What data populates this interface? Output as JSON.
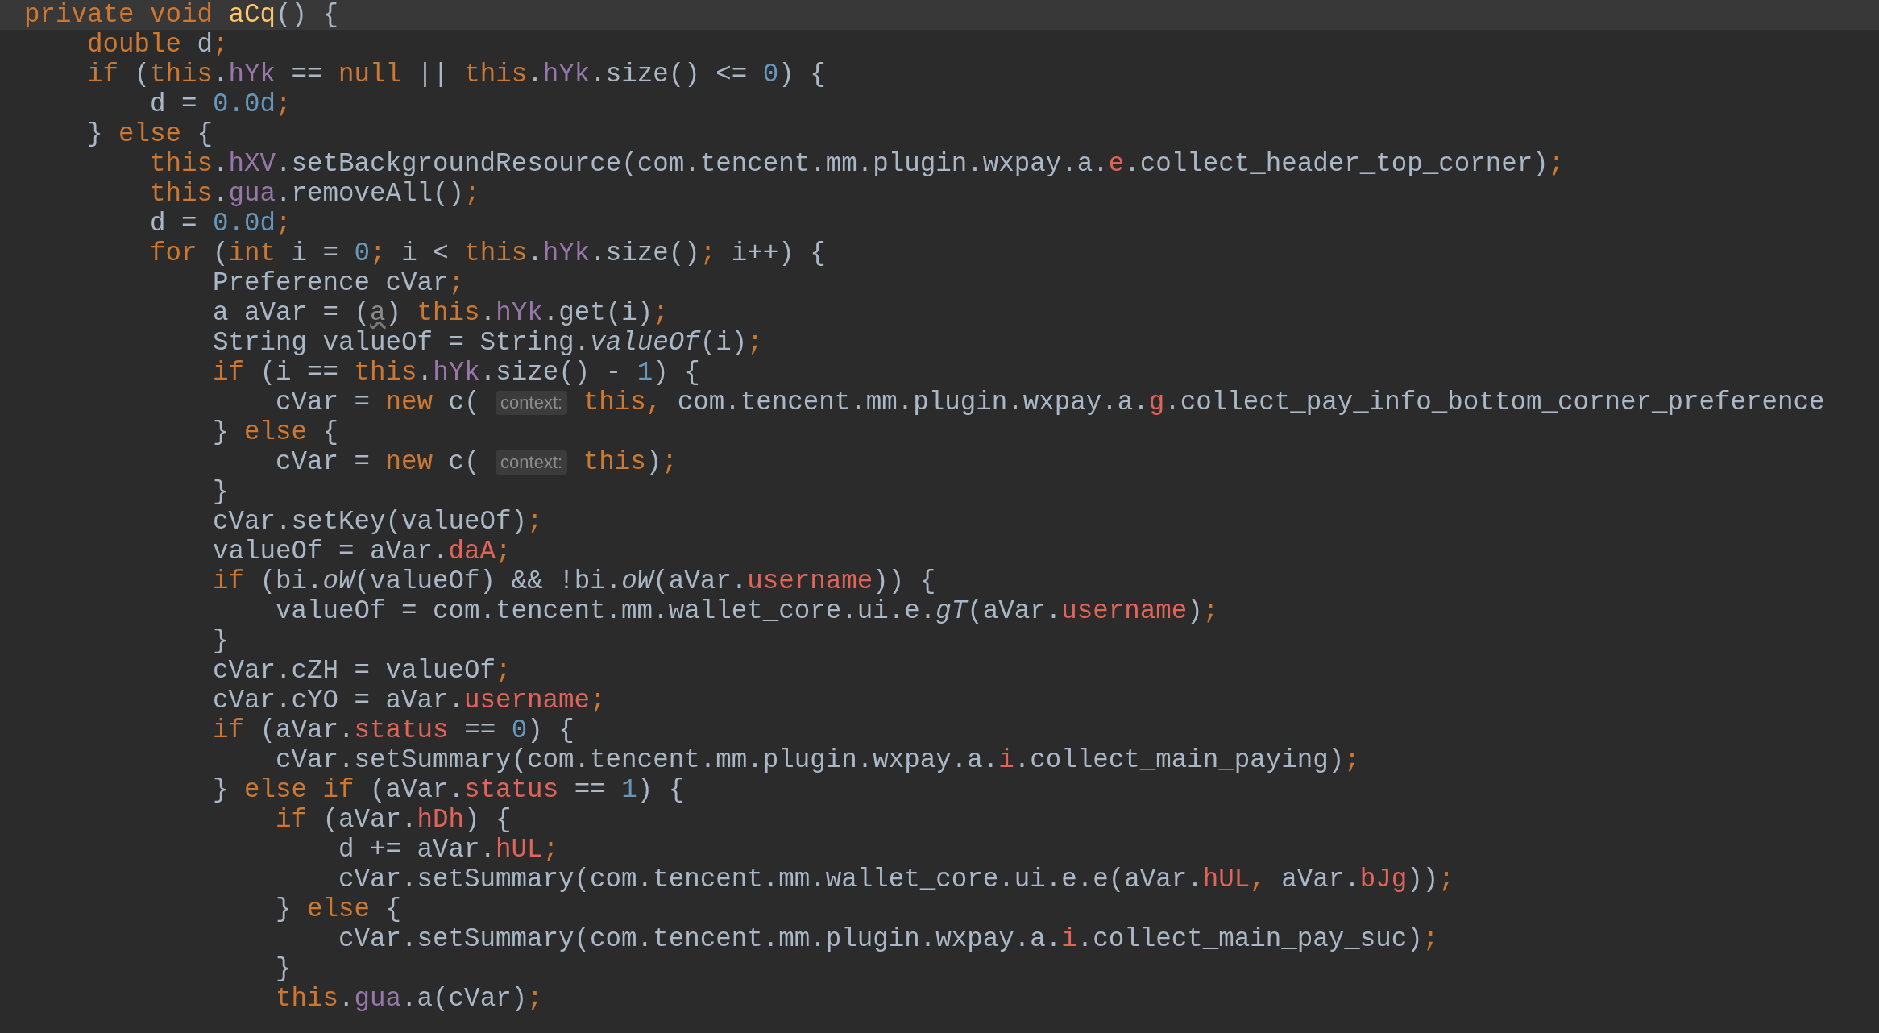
{
  "editor": {
    "lines": [
      {
        "current": true,
        "tokens": [
          {
            "kind": "keyword",
            "text": "private void "
          },
          {
            "kind": "declaration",
            "text": "aCq"
          },
          {
            "kind": "plain",
            "text": "() {"
          }
        ]
      },
      {
        "current": false,
        "tokens": [
          {
            "kind": "keyword",
            "text": "    double "
          },
          {
            "kind": "plain",
            "text": "d"
          },
          {
            "kind": "keyword",
            "text": ";"
          }
        ]
      },
      {
        "current": false,
        "tokens": [
          {
            "kind": "keyword",
            "text": "    if "
          },
          {
            "kind": "plain",
            "text": "("
          },
          {
            "kind": "keyword",
            "text": "this"
          },
          {
            "kind": "plain",
            "text": "."
          },
          {
            "kind": "field",
            "text": "hYk"
          },
          {
            "kind": "plain",
            "text": " == "
          },
          {
            "kind": "keyword",
            "text": "null"
          },
          {
            "kind": "plain",
            "text": " || "
          },
          {
            "kind": "keyword",
            "text": "this"
          },
          {
            "kind": "plain",
            "text": "."
          },
          {
            "kind": "field",
            "text": "hYk"
          },
          {
            "kind": "plain",
            "text": ".size() <= "
          },
          {
            "kind": "number",
            "text": "0"
          },
          {
            "kind": "plain",
            "text": ") {"
          }
        ]
      },
      {
        "current": false,
        "tokens": [
          {
            "kind": "plain",
            "text": "        d = "
          },
          {
            "kind": "number",
            "text": "0.0d"
          },
          {
            "kind": "keyword",
            "text": ";"
          }
        ]
      },
      {
        "current": false,
        "tokens": [
          {
            "kind": "plain",
            "text": "    } "
          },
          {
            "kind": "keyword",
            "text": "else "
          },
          {
            "kind": "plain",
            "text": "{"
          }
        ]
      },
      {
        "current": false,
        "tokens": [
          {
            "kind": "keyword",
            "text": "        this"
          },
          {
            "kind": "plain",
            "text": "."
          },
          {
            "kind": "field",
            "text": "hXV"
          },
          {
            "kind": "plain",
            "text": ".setBackgroundResource(com.tencent.mm.plugin.wxpay.a."
          },
          {
            "kind": "red",
            "text": "e"
          },
          {
            "kind": "plain",
            "text": ".collect_header_top_corner)"
          },
          {
            "kind": "keyword",
            "text": ";"
          }
        ]
      },
      {
        "current": false,
        "tokens": [
          {
            "kind": "keyword",
            "text": "        this"
          },
          {
            "kind": "plain",
            "text": "."
          },
          {
            "kind": "field",
            "text": "gua"
          },
          {
            "kind": "plain",
            "text": ".removeAll()"
          },
          {
            "kind": "keyword",
            "text": ";"
          }
        ]
      },
      {
        "current": false,
        "tokens": [
          {
            "kind": "plain",
            "text": "        d = "
          },
          {
            "kind": "number",
            "text": "0.0d"
          },
          {
            "kind": "keyword",
            "text": ";"
          }
        ]
      },
      {
        "current": false,
        "tokens": [
          {
            "kind": "keyword",
            "text": "        for "
          },
          {
            "kind": "plain",
            "text": "("
          },
          {
            "kind": "keyword",
            "text": "int "
          },
          {
            "kind": "plain",
            "text": "i = "
          },
          {
            "kind": "number",
            "text": "0"
          },
          {
            "kind": "keyword",
            "text": "; "
          },
          {
            "kind": "plain",
            "text": "i < "
          },
          {
            "kind": "keyword",
            "text": "this"
          },
          {
            "kind": "plain",
            "text": "."
          },
          {
            "kind": "field",
            "text": "hYk"
          },
          {
            "kind": "plain",
            "text": ".size()"
          },
          {
            "kind": "keyword",
            "text": "; "
          },
          {
            "kind": "plain",
            "text": "i++) {"
          }
        ]
      },
      {
        "current": false,
        "tokens": [
          {
            "kind": "plain",
            "text": "            Preference cVar"
          },
          {
            "kind": "keyword",
            "text": ";"
          }
        ]
      },
      {
        "current": false,
        "tokens": [
          {
            "kind": "plain",
            "text": "            a aVar = ("
          },
          {
            "kind": "muted",
            "text": "a"
          },
          {
            "kind": "plain",
            "text": ") "
          },
          {
            "kind": "keyword",
            "text": "this"
          },
          {
            "kind": "plain",
            "text": "."
          },
          {
            "kind": "field",
            "text": "hYk"
          },
          {
            "kind": "plain",
            "text": ".get(i)"
          },
          {
            "kind": "keyword",
            "text": ";"
          }
        ]
      },
      {
        "current": false,
        "tokens": [
          {
            "kind": "plain",
            "text": "            String valueOf = String."
          },
          {
            "kind": "static",
            "text": "valueOf"
          },
          {
            "kind": "plain",
            "text": "(i)"
          },
          {
            "kind": "keyword",
            "text": ";"
          }
        ]
      },
      {
        "current": false,
        "tokens": [
          {
            "kind": "keyword",
            "text": "            if "
          },
          {
            "kind": "plain",
            "text": "(i == "
          },
          {
            "kind": "keyword",
            "text": "this"
          },
          {
            "kind": "plain",
            "text": "."
          },
          {
            "kind": "field",
            "text": "hYk"
          },
          {
            "kind": "plain",
            "text": ".size() - "
          },
          {
            "kind": "number",
            "text": "1"
          },
          {
            "kind": "plain",
            "text": ") {"
          }
        ]
      },
      {
        "current": false,
        "tokens": [
          {
            "kind": "plain",
            "text": "                cVar = "
          },
          {
            "kind": "keyword",
            "text": "new "
          },
          {
            "kind": "plain",
            "text": "c( "
          },
          {
            "kind": "hint",
            "text": "context:"
          },
          {
            "kind": "keyword",
            "text": " this, "
          },
          {
            "kind": "plain",
            "text": "com.tencent.mm.plugin.wxpay.a."
          },
          {
            "kind": "red",
            "text": "g"
          },
          {
            "kind": "plain",
            "text": ".collect_pay_info_bottom_corner_preference"
          }
        ]
      },
      {
        "current": false,
        "tokens": [
          {
            "kind": "plain",
            "text": "            } "
          },
          {
            "kind": "keyword",
            "text": "else "
          },
          {
            "kind": "plain",
            "text": "{"
          }
        ]
      },
      {
        "current": false,
        "tokens": [
          {
            "kind": "plain",
            "text": "                cVar = "
          },
          {
            "kind": "keyword",
            "text": "new "
          },
          {
            "kind": "plain",
            "text": "c( "
          },
          {
            "kind": "hint",
            "text": "context:"
          },
          {
            "kind": "keyword",
            "text": " this"
          },
          {
            "kind": "plain",
            "text": ")"
          },
          {
            "kind": "keyword",
            "text": ";"
          }
        ]
      },
      {
        "current": false,
        "tokens": [
          {
            "kind": "plain",
            "text": "            }"
          }
        ]
      },
      {
        "current": false,
        "tokens": [
          {
            "kind": "plain",
            "text": "            cVar.setKey(valueOf)"
          },
          {
            "kind": "keyword",
            "text": ";"
          }
        ]
      },
      {
        "current": false,
        "tokens": [
          {
            "kind": "plain",
            "text": "            valueOf = aVar."
          },
          {
            "kind": "red",
            "text": "daA"
          },
          {
            "kind": "keyword",
            "text": ";"
          }
        ]
      },
      {
        "current": false,
        "tokens": [
          {
            "kind": "keyword",
            "text": "            if "
          },
          {
            "kind": "plain",
            "text": "(bi."
          },
          {
            "kind": "static",
            "text": "oW"
          },
          {
            "kind": "plain",
            "text": "(valueOf) && !bi."
          },
          {
            "kind": "static",
            "text": "oW"
          },
          {
            "kind": "plain",
            "text": "(aVar."
          },
          {
            "kind": "red",
            "text": "username"
          },
          {
            "kind": "plain",
            "text": ")) {"
          }
        ]
      },
      {
        "current": false,
        "tokens": [
          {
            "kind": "plain",
            "text": "                valueOf = com.tencent.mm.wallet_core.ui.e."
          },
          {
            "kind": "static",
            "text": "gT"
          },
          {
            "kind": "plain",
            "text": "(aVar."
          },
          {
            "kind": "red",
            "text": "username"
          },
          {
            "kind": "plain",
            "text": ")"
          },
          {
            "kind": "keyword",
            "text": ";"
          }
        ]
      },
      {
        "current": false,
        "tokens": [
          {
            "kind": "plain",
            "text": "            }"
          }
        ]
      },
      {
        "current": false,
        "tokens": [
          {
            "kind": "plain",
            "text": "            cVar.cZH = valueOf"
          },
          {
            "kind": "keyword",
            "text": ";"
          }
        ]
      },
      {
        "current": false,
        "tokens": [
          {
            "kind": "plain",
            "text": "            cVar.cYO = aVar."
          },
          {
            "kind": "red",
            "text": "username"
          },
          {
            "kind": "keyword",
            "text": ";"
          }
        ]
      },
      {
        "current": false,
        "tokens": [
          {
            "kind": "keyword",
            "text": "            if "
          },
          {
            "kind": "plain",
            "text": "(aVar."
          },
          {
            "kind": "red",
            "text": "status"
          },
          {
            "kind": "plain",
            "text": " == "
          },
          {
            "kind": "number",
            "text": "0"
          },
          {
            "kind": "plain",
            "text": ") {"
          }
        ]
      },
      {
        "current": false,
        "tokens": [
          {
            "kind": "plain",
            "text": "                cVar.setSummary(com.tencent.mm.plugin.wxpay.a."
          },
          {
            "kind": "red",
            "text": "i"
          },
          {
            "kind": "plain",
            "text": ".collect_main_paying)"
          },
          {
            "kind": "keyword",
            "text": ";"
          }
        ]
      },
      {
        "current": false,
        "tokens": [
          {
            "kind": "plain",
            "text": "            } "
          },
          {
            "kind": "keyword",
            "text": "else if "
          },
          {
            "kind": "plain",
            "text": "(aVar."
          },
          {
            "kind": "red",
            "text": "status"
          },
          {
            "kind": "plain",
            "text": " == "
          },
          {
            "kind": "number",
            "text": "1"
          },
          {
            "kind": "plain",
            "text": ") {"
          }
        ]
      },
      {
        "current": false,
        "tokens": [
          {
            "kind": "keyword",
            "text": "                if "
          },
          {
            "kind": "plain",
            "text": "(aVar."
          },
          {
            "kind": "red",
            "text": "hDh"
          },
          {
            "kind": "plain",
            "text": ") {"
          }
        ]
      },
      {
        "current": false,
        "tokens": [
          {
            "kind": "plain",
            "text": "                    d += aVar."
          },
          {
            "kind": "red",
            "text": "hUL"
          },
          {
            "kind": "keyword",
            "text": ";"
          }
        ]
      },
      {
        "current": false,
        "tokens": [
          {
            "kind": "plain",
            "text": "                    cVar.setSummary(com.tencent.mm.wallet_core.ui.e.e(aVar."
          },
          {
            "kind": "red",
            "text": "hUL"
          },
          {
            "kind": "keyword",
            "text": ", "
          },
          {
            "kind": "plain",
            "text": "aVar."
          },
          {
            "kind": "red",
            "text": "bJg"
          },
          {
            "kind": "plain",
            "text": "))"
          },
          {
            "kind": "keyword",
            "text": ";"
          }
        ]
      },
      {
        "current": false,
        "tokens": [
          {
            "kind": "plain",
            "text": "                } "
          },
          {
            "kind": "keyword",
            "text": "else "
          },
          {
            "kind": "plain",
            "text": "{"
          }
        ]
      },
      {
        "current": false,
        "tokens": [
          {
            "kind": "plain",
            "text": "                    cVar.setSummary(com.tencent.mm.plugin.wxpay.a."
          },
          {
            "kind": "red",
            "text": "i"
          },
          {
            "kind": "plain",
            "text": ".collect_main_pay_suc)"
          },
          {
            "kind": "keyword",
            "text": ";"
          }
        ]
      },
      {
        "current": false,
        "tokens": [
          {
            "kind": "plain",
            "text": "                }"
          }
        ]
      },
      {
        "current": false,
        "tokens": [
          {
            "kind": "keyword",
            "text": "                this"
          },
          {
            "kind": "plain",
            "text": "."
          },
          {
            "kind": "field",
            "text": "gua"
          },
          {
            "kind": "plain",
            "text": ".a(cVar)"
          },
          {
            "kind": "keyword",
            "text": ";"
          }
        ]
      }
    ]
  }
}
